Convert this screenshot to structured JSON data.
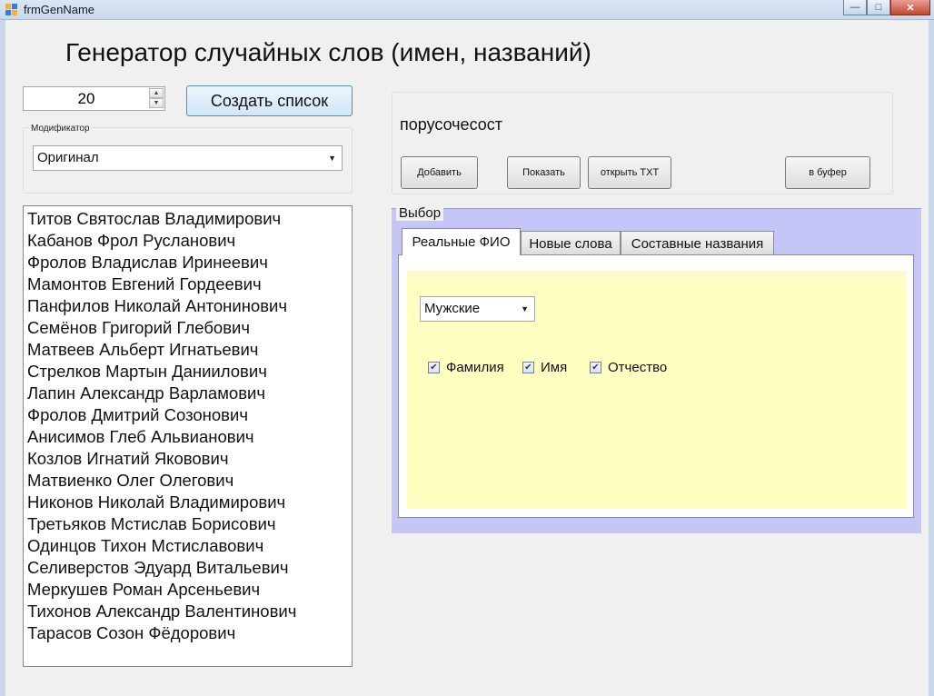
{
  "window": {
    "title": "frmGenName"
  },
  "heading": "Генератор случайных слов (имен, названий)",
  "count": {
    "value": "20"
  },
  "create_button": "Создать список",
  "modifier": {
    "label": "Модификатор",
    "selected": "Оригинал"
  },
  "names": [
    "Титов Святослав Владимирович",
    "Кабанов Фрол Русланович",
    "Фролов Владислав Иринеевич",
    "Мамонтов Евгений Гордеевич",
    "Панфилов Николай Антонинович",
    "Семёнов Григорий Глебович",
    "Матвеев Альберт Игнатьевич",
    "Стрелков Мартын Даниилович",
    "Лапин Александр Варламович",
    "Фролов Дмитрий Созонович",
    "Анисимов Глеб Альвианович",
    "Козлов Игнатий Яковович",
    "Матвиенко Олег Олегович",
    "Никонов Николай Владимирович",
    "Третьяков Мстислав Борисович",
    "Одинцов Тихон Мстиславович",
    "Селиверстов Эдуард Витальевич",
    "Меркушев Роман Арсеньевич",
    "Тихонов Александр Валентинович",
    "Тарасов Созон Фёдорович"
  ],
  "generated_word": "порусочесост",
  "actions": {
    "add": "Добавить",
    "show": "Показать",
    "open_txt": "открыть TXT",
    "to_clipboard": "в буфер"
  },
  "choice": {
    "label": "Выбор",
    "tabs": [
      "Реальные ФИО",
      "Новые слова",
      "Составные названия"
    ],
    "gender": {
      "selected": "Мужские"
    },
    "checks": [
      {
        "label": "Фамилия",
        "checked": true
      },
      {
        "label": "Имя",
        "checked": true
      },
      {
        "label": "Отчество",
        "checked": true
      }
    ]
  },
  "colors": {
    "choice_background": "#c5c5f7",
    "tab_panel": "#ffffc2"
  }
}
